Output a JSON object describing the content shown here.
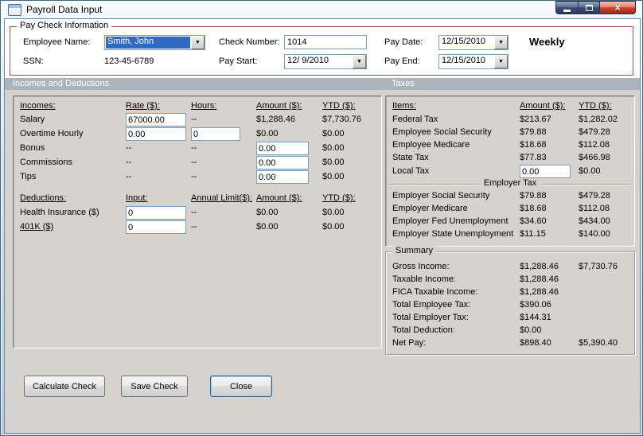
{
  "window": {
    "title": "Payroll Data Input"
  },
  "icons": {
    "dropdown": "▼",
    "close": "×"
  },
  "colors": {
    "selection": "#316ac5",
    "groupbox_border": "#a0524d",
    "section_header_bg": "#a9b6bd",
    "panel_bg": "#d6d3ce",
    "close_button": "#cc4632"
  },
  "paycheck": {
    "legend": "Pay Check Information",
    "employee_name": {
      "label": "Employee Name:",
      "value": "Smith, John"
    },
    "ssn": {
      "label": "SSN:",
      "value": "123-45-6789"
    },
    "check_number": {
      "label": "Check Number:",
      "value": "1014"
    },
    "pay_start": {
      "label": "Pay Start:",
      "value": "12/ 9/2010"
    },
    "pay_date": {
      "label": "Pay Date:",
      "value": "12/15/2010"
    },
    "pay_end": {
      "label": "Pay End:",
      "value": "12/15/2010"
    },
    "frequency": "Weekly"
  },
  "section_headers": {
    "left": "Incomes and Deductions",
    "right": "Taxes"
  },
  "incomes": {
    "headers": {
      "name": "Incomes:",
      "rate": "Rate ($):",
      "hours": "Hours:",
      "amount": "Amount ($):",
      "ytd": "YTD ($):"
    },
    "rows": [
      {
        "name": "Salary",
        "rate": "67000.00",
        "hours": "--",
        "amount": "$1,288.46",
        "ytd": "$7,730.76"
      },
      {
        "name": "Overtime Hourly",
        "rate": "0.00",
        "hours": "0",
        "amount": "$0.00",
        "ytd": "$0.00"
      },
      {
        "name": "Bonus",
        "rate": "--",
        "hours": "--",
        "amount": "0.00",
        "ytd": "$0.00"
      },
      {
        "name": "Commissions",
        "rate": "--",
        "hours": "--",
        "amount": "0.00",
        "ytd": "$0.00"
      },
      {
        "name": "Tips",
        "rate": "--",
        "hours": "--",
        "amount": "0.00",
        "ytd": "$0.00"
      }
    ]
  },
  "deductions": {
    "headers": {
      "name": "Deductions:",
      "input": "Input:",
      "limit": "Annual Limit($):",
      "amount": "Amount ($):",
      "ytd": "YTD ($):"
    },
    "rows": [
      {
        "name": "Health Insurance  ($)",
        "input": "0",
        "limit": "--",
        "amount": "$0.00",
        "ytd": "$0.00"
      },
      {
        "name": "401K  ($)",
        "input": "0",
        "limit": "--",
        "amount": "$0.00",
        "ytd": "$0.00"
      }
    ]
  },
  "taxes": {
    "headers": {
      "name": "Items:",
      "amount": "Amount ($):",
      "ytd": "YTD ($):"
    },
    "employee_rows": [
      {
        "name": "Federal Tax",
        "amount": "$213.67",
        "ytd": "$1,282.02"
      },
      {
        "name": "Employee Social Security",
        "amount": "$79.88",
        "ytd": "$479.28"
      },
      {
        "name": "Employee Medicare",
        "amount": "$18.68",
        "ytd": "$112.08"
      },
      {
        "name": "State Tax",
        "amount": "$77.83",
        "ytd": "$466.98"
      },
      {
        "name": "Local Tax",
        "amount": "0.00",
        "ytd": "$0.00"
      }
    ],
    "employer_legend": "Employer Tax",
    "employer_rows": [
      {
        "name": "Employer Social Security",
        "amount": "$79.88",
        "ytd": "$479.28"
      },
      {
        "name": "Employer Medicare",
        "amount": "$18.68",
        "ytd": "$112.08"
      },
      {
        "name": "Employer Fed Unemployment",
        "amount": "$34.60",
        "ytd": "$434.00"
      },
      {
        "name": "Employer State Unemployment",
        "amount": "$11.15",
        "ytd": "$140.00"
      }
    ]
  },
  "summary": {
    "legend": "Summary",
    "rows": [
      {
        "name": "Gross Income:",
        "amount": "$1,288.46",
        "ytd": "$7,730.76"
      },
      {
        "name": "Taxable Income:",
        "amount": "$1,288.46",
        "ytd": ""
      },
      {
        "name": "FICA Taxable Income:",
        "amount": "$1,288.46",
        "ytd": ""
      },
      {
        "name": "Total Employee Tax:",
        "amount": "$390.06",
        "ytd": ""
      },
      {
        "name": "Total Employer Tax:",
        "amount": "$144.31",
        "ytd": ""
      },
      {
        "name": "Total Deduction:",
        "amount": "$0.00",
        "ytd": ""
      },
      {
        "name": "Net Pay:",
        "amount": "$898.40",
        "ytd": "$5,390.40"
      }
    ]
  },
  "buttons": {
    "calculate": "Calculate Check",
    "save": "Save Check",
    "close": "Close"
  }
}
